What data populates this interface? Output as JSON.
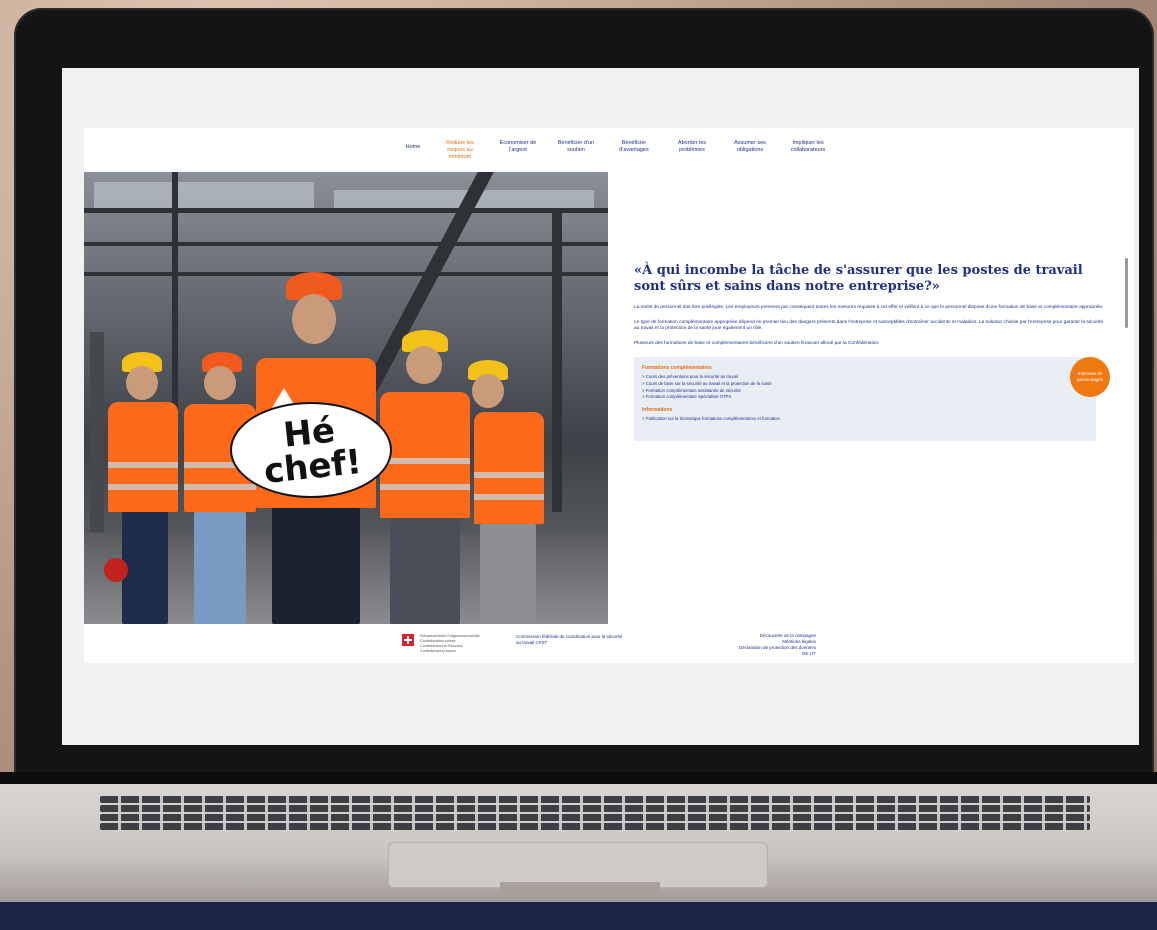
{
  "nav": {
    "home": "Home",
    "items": [
      {
        "label": "Réduire les risques au minimum",
        "active": true
      },
      {
        "label": "Économiser de l'argent",
        "active": false
      },
      {
        "label": "Bénéficier d'un soutien",
        "active": false
      },
      {
        "label": "Bénéficier d'avantages",
        "active": false
      },
      {
        "label": "Aborder les problèmes",
        "active": false
      },
      {
        "label": "Assumer ses obligations",
        "active": false
      },
      {
        "label": "Impliquer les collaborateurs",
        "active": false
      }
    ]
  },
  "hero": {
    "bubble_text": "Hé chef!"
  },
  "content": {
    "headline": "«À qui incombe la tâche de s'assurer que les postes de travail sont sûrs et sains dans notre entreprise?»",
    "paragraphs": [
      "La santé du personnel doit être privilégiée. Les employeurs prennent par conséquent toutes les mesures requises à cet effet et veillent à ce que le personnel dispose d'une formation de base et complémentaire appropriée.",
      "Le type de formation complémentaire appropriée dépend en premier lieu des dangers présents dans l'entreprise et susceptibles d'entraîner accidents et maladies. La solution choisie par l'entreprise pour garantir la sécurité au travail et la protection de la santé joue également un rôle.",
      "Plusieurs des formations de base et complémentaires bénéficient d'un soutien financier alloué par la Confédération."
    ],
    "box": {
      "section1_title": "Formations complémentaires",
      "section1_links": [
        "> Cours des préventions pour la sécurité au travail",
        "> Cours de base sur la sécurité au travail et la protection de la santé",
        "> Formation complémentaire assistant/e de sécurité",
        "> Formation complémentaire Spécialiste STPS"
      ],
      "section2_title": "Informations",
      "section2_links": [
        "> Publication sur la thématique formations complémentaires et formation"
      ],
      "badge": "Interview de personnages"
    }
  },
  "footer": {
    "federal_lines": [
      "Schweizerische Eidgenossenschaft",
      "Confédération suisse",
      "Confederazione Svizzera",
      "Confederaziun svizra"
    ],
    "cfst": "Commission fédérale de coordination pour la sécurité au travail CFST",
    "links": [
      "Découverte de la campagne",
      "Mentions légales",
      "Déclaration de protection des données",
      "DE | IT"
    ]
  }
}
